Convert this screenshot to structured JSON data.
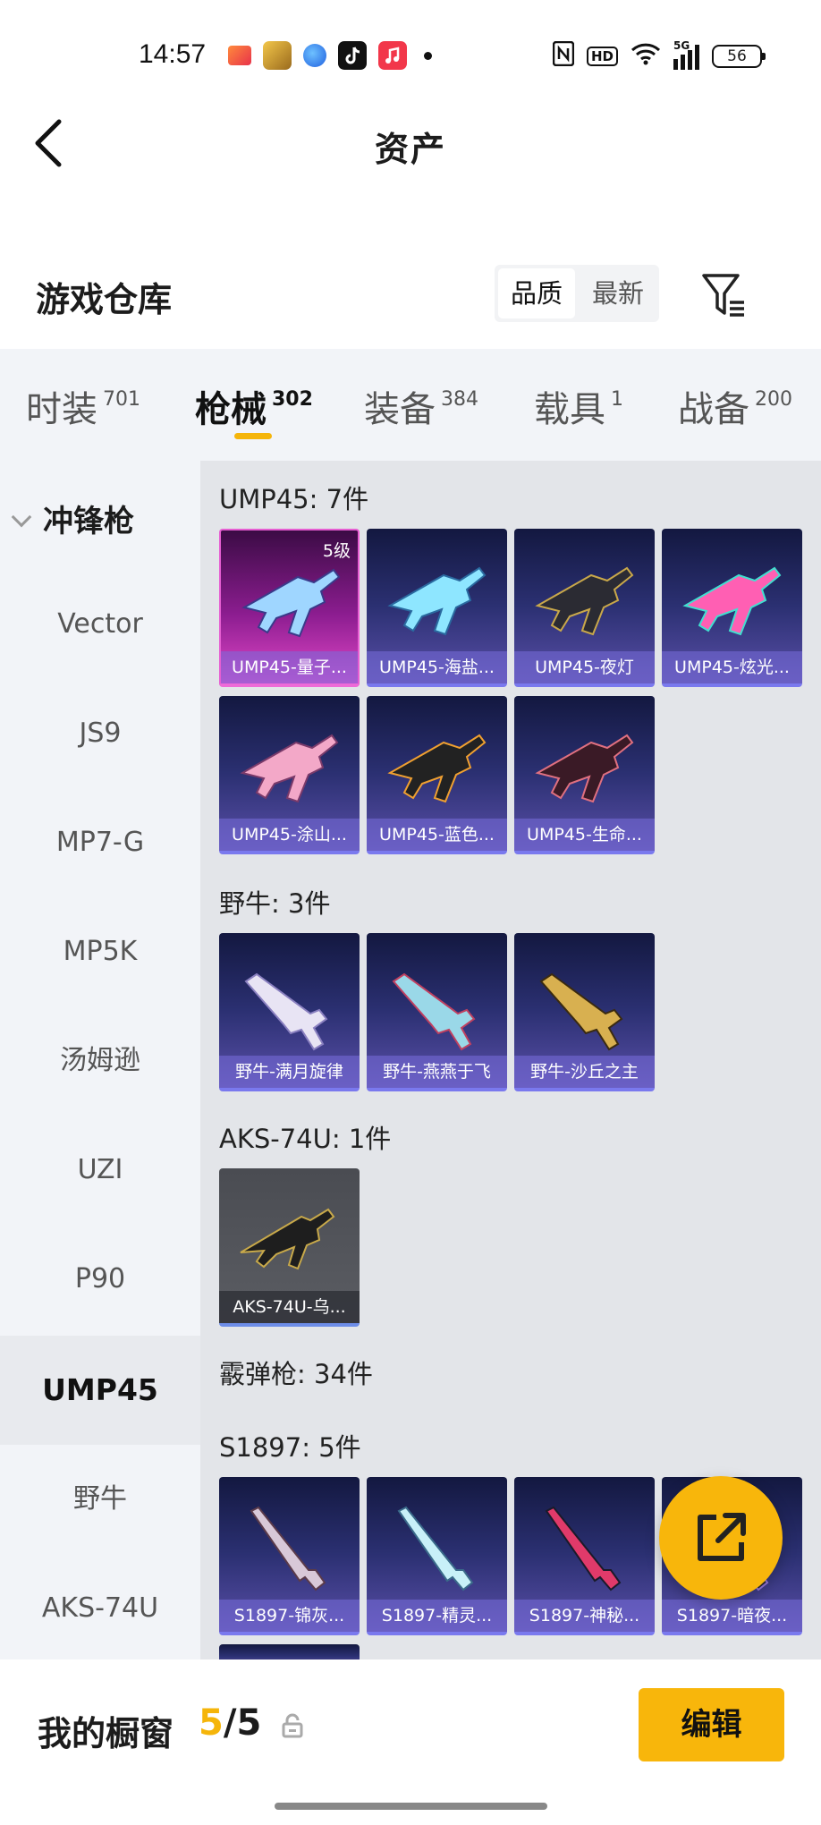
{
  "status_bar": {
    "time": "14:57",
    "battery": "56",
    "network": "5G",
    "hd": "HD"
  },
  "header": {
    "title": "资产"
  },
  "warehouse": {
    "title": "游戏仓库",
    "sort_options": [
      "品质",
      "最新"
    ]
  },
  "tabs": [
    {
      "label": "时装",
      "count": "701"
    },
    {
      "label": "枪械",
      "count": "302"
    },
    {
      "label": "装备",
      "count": "384"
    },
    {
      "label": "载具",
      "count": "1"
    },
    {
      "label": "战备",
      "count": "200"
    }
  ],
  "sidebar": {
    "category": "冲锋枪",
    "items": [
      "Vector",
      "JS9",
      "MP7-G",
      "MP5K",
      "汤姆逊",
      "UZI",
      "P90",
      "UMP45",
      "野牛",
      "AKS-74U"
    ]
  },
  "groups": [
    {
      "title": "UMP45: 7件",
      "items": [
        {
          "name": "UMP45-量子...",
          "level": "5级"
        },
        {
          "name": "UMP45-海盐..."
        },
        {
          "name": "UMP45-夜灯"
        },
        {
          "name": "UMP45-炫光..."
        },
        {
          "name": "UMP45-涂山..."
        },
        {
          "name": "UMP45-蓝色..."
        },
        {
          "name": "UMP45-生命..."
        }
      ]
    },
    {
      "title": "野牛: 3件",
      "items": [
        {
          "name": "野牛-满月旋律"
        },
        {
          "name": "野牛-燕燕于飞"
        },
        {
          "name": "野牛-沙丘之主"
        }
      ]
    },
    {
      "title": "AKS-74U: 1件",
      "items": [
        {
          "name": "AKS-74U-乌..."
        }
      ]
    },
    {
      "title": "霰弹枪: 34件"
    },
    {
      "title": "S1897: 5件",
      "items": [
        {
          "name": "S1897-锦灰..."
        },
        {
          "name": "S1897-精灵..."
        },
        {
          "name": "S1897-神秘..."
        },
        {
          "name": "S1897-暗夜..."
        }
      ]
    }
  ],
  "showcase": {
    "title": "我的橱窗",
    "current": "5",
    "separator": "/",
    "total": "5",
    "edit_label": "编辑"
  },
  "colors": {
    "accent": "#f8b60b",
    "legendary": "#e248c8",
    "epic": "#5a4fa8"
  }
}
